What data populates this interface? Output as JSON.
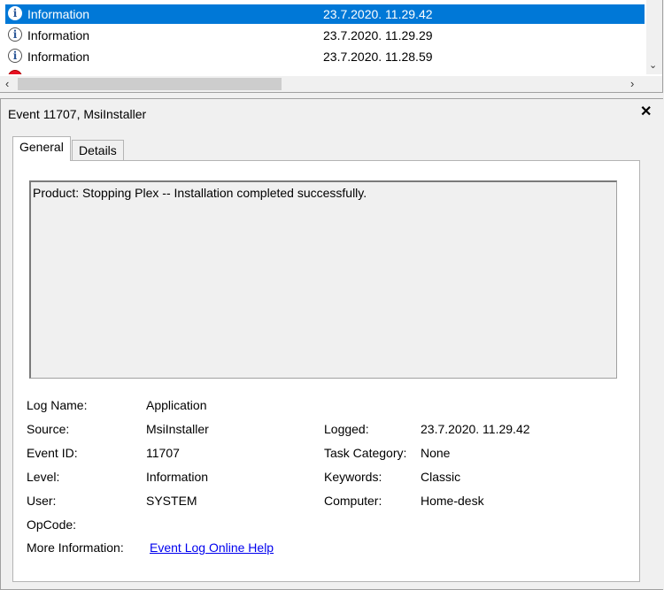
{
  "event_list": {
    "rows": [
      {
        "level": "Information",
        "datetime": "23.7.2020. 11.29.42",
        "selected": true
      },
      {
        "level": "Information",
        "datetime": "23.7.2020. 11.29.29",
        "selected": false
      },
      {
        "level": "Information",
        "datetime": "23.7.2020. 11.28.59",
        "selected": false
      }
    ],
    "row_icon": "info-icon",
    "partial_row_icon": "error-icon",
    "selection_color": "#0078d7"
  },
  "detail": {
    "title": "Event 11707, MsiInstaller",
    "close_glyph": "✕",
    "tabs": [
      {
        "label": "General",
        "active": true
      },
      {
        "label": "Details",
        "active": false
      }
    ],
    "message": "Product: Stopping Plex -- Installation completed successfully.",
    "fields": {
      "log_name": {
        "label": "Log Name:",
        "value": "Application"
      },
      "source": {
        "label": "Source:",
        "value": "MsiInstaller"
      },
      "event_id": {
        "label": "Event ID:",
        "value": "11707"
      },
      "level": {
        "label": "Level:",
        "value": "Information"
      },
      "user": {
        "label": "User:",
        "value": "SYSTEM"
      },
      "opcode": {
        "label": "OpCode:",
        "value": ""
      },
      "more_info": {
        "label": "More Information:",
        "value": "Event Log Online Help"
      },
      "logged": {
        "label": "Logged:",
        "value": "23.7.2020. 11.29.42"
      },
      "task_category": {
        "label": "Task Category:",
        "value": "None"
      },
      "keywords": {
        "label": "Keywords:",
        "value": "Classic"
      },
      "computer": {
        "label": "Computer:",
        "value": "Home-desk"
      }
    },
    "link_color": "#0000ee"
  }
}
